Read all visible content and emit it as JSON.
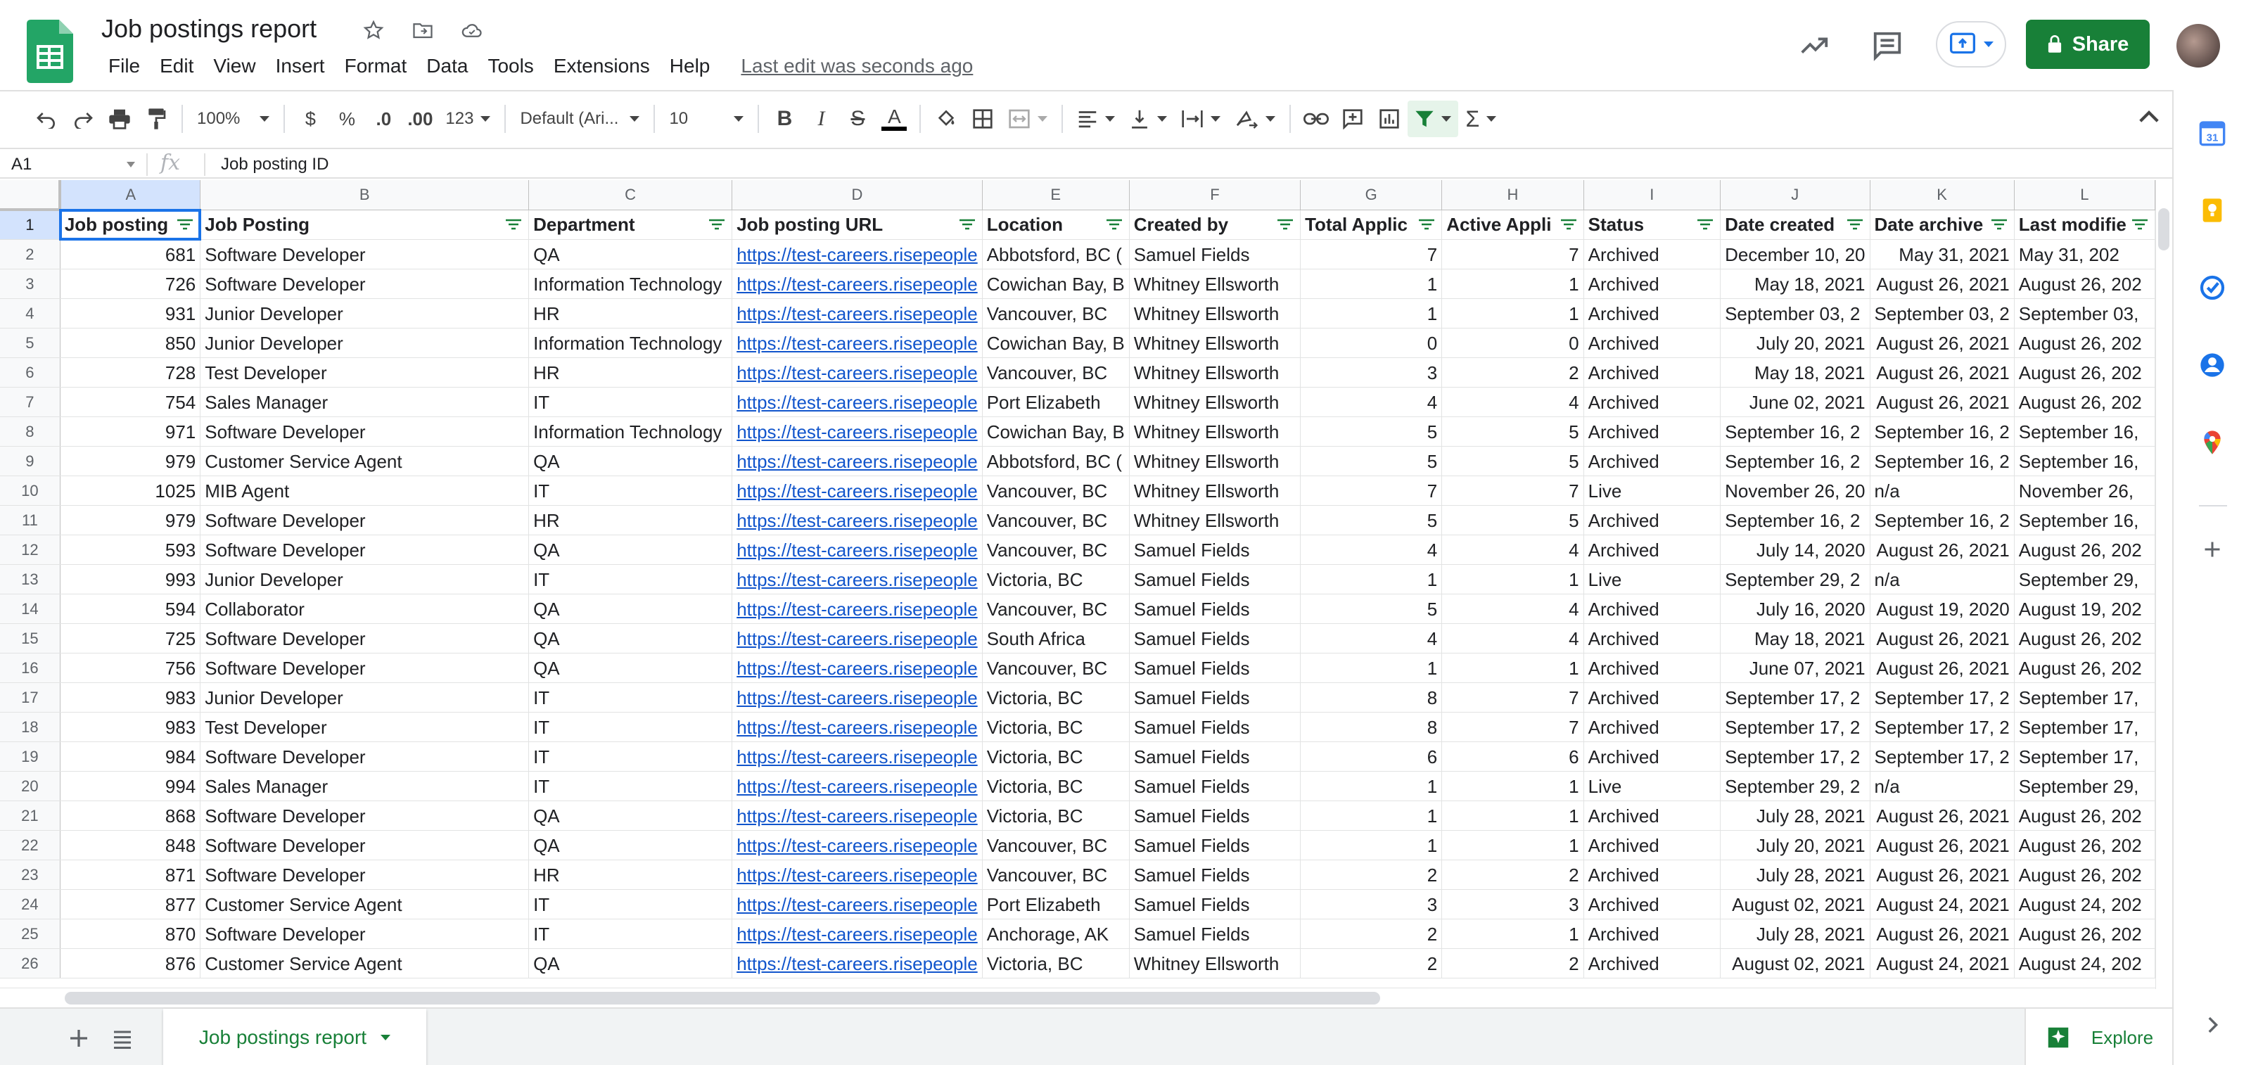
{
  "doc": {
    "title": "Job postings report",
    "last_edit": "Last edit was seconds ago",
    "share_label": "Share"
  },
  "menu": [
    "File",
    "Edit",
    "View",
    "Insert",
    "Format",
    "Data",
    "Tools",
    "Extensions",
    "Help"
  ],
  "toolbar": {
    "zoom": "100%",
    "currency": "$",
    "percent": "%",
    "dec_decrease": ".0",
    "dec_increase": ".00",
    "more_formats": "123",
    "font": "Default (Ari...",
    "font_size": "10"
  },
  "formula_bar": {
    "cell_ref": "A1",
    "fx": "fx",
    "content": "Job posting ID"
  },
  "grid": {
    "columns": [
      "A",
      "B",
      "C",
      "D",
      "E",
      "F",
      "G",
      "H",
      "I",
      "J",
      "K",
      "L"
    ],
    "headers": [
      "Job posting",
      "Job Posting",
      "Department",
      "Job posting URL",
      "Location",
      "Created by",
      "Total Applic",
      "Active Appli",
      "Status",
      "Date created",
      "Date archive",
      "Last modifie"
    ],
    "rows": [
      [
        "2",
        "681",
        "Software Developer",
        "QA",
        "https://test-careers.risepeople",
        "Abbotsford, BC (",
        "Samuel Fields",
        "7",
        "7",
        "Archived",
        "December 10, 20",
        "May 31, 2021",
        "May 31, 202"
      ],
      [
        "3",
        "726",
        "Software Developer",
        "Information Technology",
        "https://test-careers.risepeople",
        "Cowichan Bay, B",
        "Whitney Ellsworth",
        "1",
        "1",
        "Archived",
        "May 18, 2021",
        "August 26, 2021",
        "August 26, 202"
      ],
      [
        "4",
        "931",
        "Junior Developer",
        "HR",
        "https://test-careers.risepeople",
        "Vancouver, BC",
        "Whitney Ellsworth",
        "1",
        "1",
        "Archived",
        "September 03, 2",
        "September 03, 2",
        "September 03,"
      ],
      [
        "5",
        "850",
        "Junior Developer",
        "Information Technology",
        "https://test-careers.risepeople",
        "Cowichan Bay, B",
        "Whitney Ellsworth",
        "0",
        "0",
        "Archived",
        "July 20, 2021",
        "August 26, 2021",
        "August 26, 202"
      ],
      [
        "6",
        "728",
        "Test Developer",
        "HR",
        "https://test-careers.risepeople",
        "Vancouver, BC",
        "Whitney Ellsworth",
        "3",
        "2",
        "Archived",
        "May 18, 2021",
        "August 26, 2021",
        "August 26, 202"
      ],
      [
        "7",
        "754",
        "Sales Manager",
        "IT",
        "https://test-careers.risepeople",
        "Port Elizabeth",
        "Whitney Ellsworth",
        "4",
        "4",
        "Archived",
        "June 02, 2021",
        "August 26, 2021",
        "August 26, 202"
      ],
      [
        "8",
        "971",
        "Software Developer",
        "Information Technology",
        "https://test-careers.risepeople",
        "Cowichan Bay, B",
        "Whitney Ellsworth",
        "5",
        "5",
        "Archived",
        "September 16, 2",
        "September 16, 2",
        "September 16,"
      ],
      [
        "9",
        "979",
        "Customer Service Agent",
        "QA",
        "https://test-careers.risepeople",
        "Abbotsford, BC (",
        "Whitney Ellsworth",
        "5",
        "5",
        "Archived",
        "September 16, 2",
        "September 16, 2",
        "September 16,"
      ],
      [
        "10",
        "1025",
        "MIB Agent",
        "IT",
        "https://test-careers.risepeople",
        "Vancouver, BC",
        "Whitney Ellsworth",
        "7",
        "7",
        "Live",
        "November 26, 20",
        "n/a",
        "November 26,"
      ],
      [
        "11",
        "979",
        "Software Developer",
        "HR",
        "https://test-careers.risepeople",
        "Vancouver, BC",
        "Whitney Ellsworth",
        "5",
        "5",
        "Archived",
        "September 16, 2",
        "September 16, 2",
        "September 16,"
      ],
      [
        "12",
        "593",
        "Software Developer",
        "QA",
        "https://test-careers.risepeople",
        "Vancouver, BC",
        "Samuel Fields",
        "4",
        "4",
        "Archived",
        "July 14, 2020",
        "August 26, 2021",
        "August 26, 202"
      ],
      [
        "13",
        "993",
        "Junior Developer",
        "IT",
        "https://test-careers.risepeople",
        "Victoria, BC",
        "Samuel Fields",
        "1",
        "1",
        "Live",
        "September 29, 2",
        "n/a",
        "September 29,"
      ],
      [
        "14",
        "594",
        "Collaborator",
        "QA",
        "https://test-careers.risepeople",
        "Vancouver, BC",
        "Samuel Fields",
        "5",
        "4",
        "Archived",
        "July 16, 2020",
        "August 19, 2020",
        "August 19, 202"
      ],
      [
        "15",
        "725",
        "Software Developer",
        "QA",
        "https://test-careers.risepeople",
        "South Africa",
        "Samuel Fields",
        "4",
        "4",
        "Archived",
        "May 18, 2021",
        "August 26, 2021",
        "August 26, 202"
      ],
      [
        "16",
        "756",
        "Software Developer",
        "QA",
        "https://test-careers.risepeople",
        "Vancouver, BC",
        "Samuel Fields",
        "1",
        "1",
        "Archived",
        "June 07, 2021",
        "August 26, 2021",
        "August 26, 202"
      ],
      [
        "17",
        "983",
        "Junior Developer",
        "IT",
        "https://test-careers.risepeople",
        "Victoria, BC",
        "Samuel Fields",
        "8",
        "7",
        "Archived",
        "September 17, 2",
        "September 17, 2",
        "September 17,"
      ],
      [
        "18",
        "983",
        "Test Developer",
        "IT",
        "https://test-careers.risepeople",
        "Victoria, BC",
        "Samuel Fields",
        "8",
        "7",
        "Archived",
        "September 17, 2",
        "September 17, 2",
        "September 17,"
      ],
      [
        "19",
        "984",
        "Software Developer",
        "IT",
        "https://test-careers.risepeople",
        "Victoria, BC",
        "Samuel Fields",
        "6",
        "6",
        "Archived",
        "September 17, 2",
        "September 17, 2",
        "September 17,"
      ],
      [
        "20",
        "994",
        "Sales Manager",
        "IT",
        "https://test-careers.risepeople",
        "Victoria, BC",
        "Samuel Fields",
        "1",
        "1",
        "Live",
        "September 29, 2",
        "n/a",
        "September 29,"
      ],
      [
        "21",
        "868",
        "Software Developer",
        "QA",
        "https://test-careers.risepeople",
        "Victoria, BC",
        "Samuel Fields",
        "1",
        "1",
        "Archived",
        "July 28, 2021",
        "August 26, 2021",
        "August 26, 202"
      ],
      [
        "22",
        "848",
        "Software Developer",
        "QA",
        "https://test-careers.risepeople",
        "Vancouver, BC",
        "Samuel Fields",
        "1",
        "1",
        "Archived",
        "July 20, 2021",
        "August 26, 2021",
        "August 26, 202"
      ],
      [
        "23",
        "871",
        "Software Developer",
        "HR",
        "https://test-careers.risepeople",
        "Vancouver, BC",
        "Samuel Fields",
        "2",
        "2",
        "Archived",
        "July 28, 2021",
        "August 26, 2021",
        "August 26, 202"
      ],
      [
        "24",
        "877",
        "Customer Service Agent",
        "IT",
        "https://test-careers.risepeople",
        "Port Elizabeth",
        "Samuel Fields",
        "3",
        "3",
        "Archived",
        "August 02, 2021",
        "August 24, 2021",
        "August 24, 202"
      ],
      [
        "25",
        "870",
        "Software Developer",
        "IT",
        "https://test-careers.risepeople",
        "Anchorage, AK",
        "Samuel Fields",
        "2",
        "1",
        "Archived",
        "July 28, 2021",
        "August 26, 2021",
        "August 26, 202"
      ],
      [
        "26",
        "876",
        "Customer Service Agent",
        "QA",
        "https://test-careers.risepeople",
        "Victoria, BC",
        "Whitney Ellsworth",
        "2",
        "2",
        "Archived",
        "August 02, 2021",
        "August 24, 2021",
        "August 24, 202"
      ]
    ]
  },
  "sheets": {
    "active_tab": "Job postings report",
    "explore_label": "Explore"
  },
  "colors": {
    "brand_green": "#188038",
    "selection_blue": "#1a73e8",
    "link_blue": "#1155cc"
  },
  "side_panel": [
    "calendar-icon",
    "keep-icon",
    "tasks-icon",
    "contacts-icon",
    "maps-icon",
    "add-icon"
  ]
}
